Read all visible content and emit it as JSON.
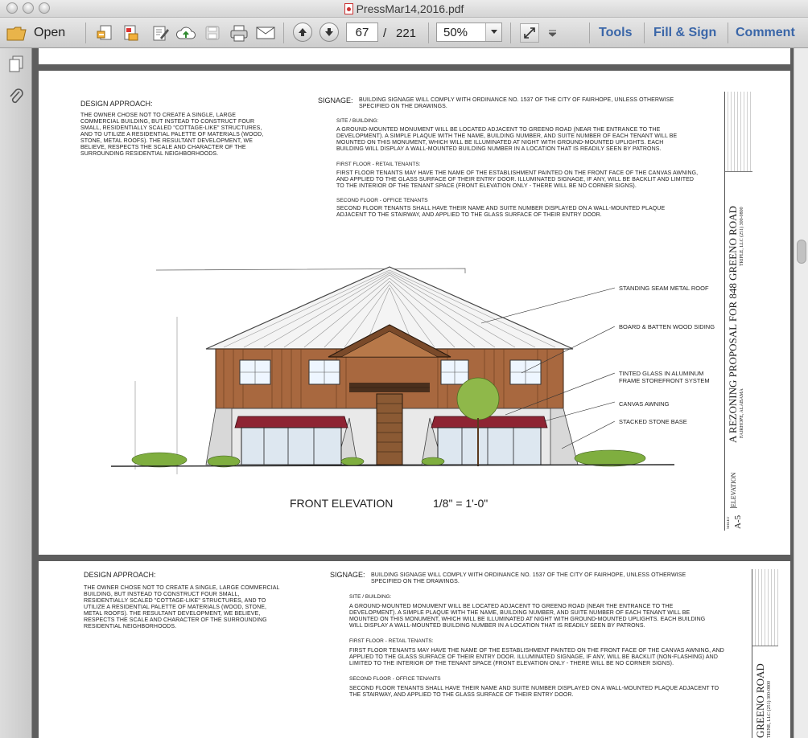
{
  "window": {
    "title": "PressMar14,2016.pdf"
  },
  "toolbar": {
    "open_label": "Open",
    "page_current": "67",
    "page_separator": "/",
    "page_total": "221",
    "zoom_value": "50%",
    "tools_label": "Tools",
    "fill_sign_label": "Fill & Sign",
    "comment_label": "Comment"
  },
  "sheet": {
    "design_approach_heading": "DESIGN APPROACH:",
    "design_approach_text": "THE OWNER CHOSE NOT TO CREATE A SINGLE, LARGE COMMERCIAL BUILDING, BUT INSTEAD TO CONSTRUCT FOUR SMALL, RESIDENTIALLY SCALED \"COTTAGE-LIKE\" STRUCTURES, AND TO UTILIZE A RESIDENTIAL PALETTE OF MATERIALS (WOOD, STONE, METAL ROOFS). THE RESULTANT DEVELOPMENT, WE BELIEVE, RESPECTS THE SCALE AND CHARACTER OF THE SURROUNDING RESIDENTIAL NEIGHBORHOODS.",
    "signage_heading": "SIGNAGE:",
    "signage_text": "BUILDING SIGNAGE WILL COMPLY WITH ORDINANCE NO. 1537 OF THE CITY OF FAIRHOPE, UNLESS OTHERWISE SPECIFIED ON THE DRAWINGS.",
    "site_heading": "SITE / BUILDING:",
    "site_text": "A GROUND-MOUNTED MONUMENT WILL BE LOCATED ADJACENT TO GREENO ROAD (NEAR THE ENTRANCE TO THE DEVELOPMENT). A SIMPLE PLAQUE WITH THE NAME, BUILDING NUMBER, AND SUITE NUMBER OF EACH TENANT WILL BE MOUNTED ON THIS MONUMENT, WHICH WILL BE ILLUMINATED AT NIGHT WITH GROUND-MOUNTED UPLIGHTS. EACH BUILDING WILL DISPLAY A WALL-MOUNTED BUILDING NUMBER IN A LOCATION THAT IS READILY SEEN BY PATRONS.",
    "first_floor_heading": "FIRST FLOOR - RETAIL TENANTS:",
    "first_floor_text": "FIRST FLOOR TENANTS MAY HAVE THE NAME OF THE ESTABLISHMENT PAINTED ON THE FRONT FACE OF THE CANVAS AWNING, AND APPLIED TO THE GLASS SURFACE OF THEIR ENTRY DOOR. ILLUMINATED SIGNAGE, IF ANY, WILL BE BACKLIT AND LIMITED TO THE INTERIOR OF THE TENANT SPACE (FRONT ELEVATION ONLY - THERE WILL BE NO CORNER SIGNS).",
    "first_floor_text_b": "FIRST FLOOR TENANTS MAY HAVE THE NAME OF THE ESTABLISHMENT PAINTED ON THE FRONT FACE OF THE CANVAS AWNING, AND APPLIED TO THE GLASS SURFACE OF THEIR ENTRY DOOR. ILLUMINATED SIGNAGE, IF ANY, WILL BE BACKLIT (NON-FLASHING) AND LIMITED TO THE INTERIOR OF THE TENANT SPACE (FRONT ELEVATION ONLY - THERE WILL BE NO CORNER SIGNS).",
    "second_floor_heading": "SECOND FLOOR - OFFICE TENANTS",
    "second_floor_text": "SECOND FLOOR TENANTS SHALL HAVE THEIR NAME AND SUITE NUMBER DISPLAYED ON A WALL-MOUNTED PLAQUE ADJACENT TO THE STAIRWAY, AND APPLIED TO THE GLASS SURFACE OF THEIR ENTRY DOOR.",
    "callouts": [
      "STANDING SEAM METAL ROOF",
      "BOARD & BATTEN WOOD SIDING",
      "TINTED GLASS IN ALUMINUM FRAME STOREFRONT SYSTEM",
      "CANVAS AWNING",
      "STACKED STONE BASE"
    ],
    "drawing_title": "FRONT ELEVATION",
    "drawing_scale": "1/8\" = 1'-0\"",
    "title_block_main": "A REZONING PROPOSAL FOR 848 GREENO ROAD",
    "title_block_partial": "GREENO ROAD",
    "title_block_location": "FAIRHOPE, ALABAMA",
    "title_block_company": "TRIPLE, LLC (251) 300-0800",
    "title_block_company_partial": "TRINE, LLC (251) 300-0800",
    "title_block_sheet_name": "ELEVATION",
    "title_block_sheet_label": "SHEET",
    "title_block_sheet_no": "A-5"
  },
  "colors": {
    "siding": "#a8683f",
    "awning": "#8e2433",
    "roof": "#f1f1f1",
    "stone": "#d8d8d8",
    "tree": "#8fb84a",
    "link": "#3a66a8"
  }
}
